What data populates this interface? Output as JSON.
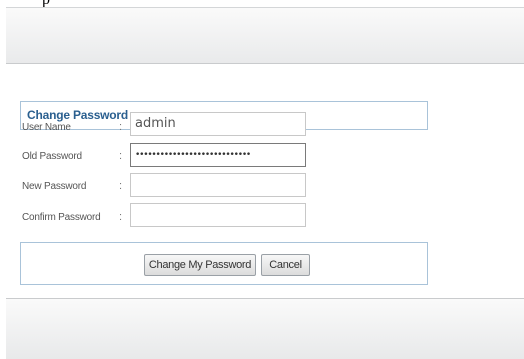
{
  "top_text": "p",
  "form": {
    "title": "Change Password",
    "rows": [
      {
        "label": "User Name",
        "value": "admin",
        "type": "text"
      },
      {
        "label": "Old Password",
        "value": "••••••••••••••••••••••••••••",
        "type": "password"
      },
      {
        "label": "New Password",
        "value": "",
        "type": "password"
      },
      {
        "label": "Confirm Password",
        "value": "",
        "type": "password"
      }
    ],
    "separator": ":"
  },
  "buttons": {
    "change_label": "Change My Password",
    "cancel_label": "Cancel"
  }
}
